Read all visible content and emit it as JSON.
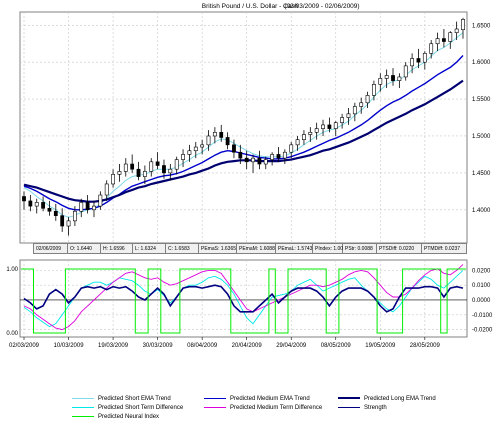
{
  "title": "British Pound / U.S. Dollar - Cash",
  "date_range": "(02/03/2009 - 02/06/2009)",
  "info_strip": [
    "02/06/2009",
    "O: 1.6440",
    "H: 1.6596",
    "L: 1.6324",
    "C: 1.6583",
    "PEmaS: 1.6365",
    "PEmaM: 1.6088",
    "PEmaL: 1.5743",
    "PIndex: 1.00",
    "PStr: 0.0088",
    "PTSDiff: 0.0220",
    "PTMDiff: 0.0237"
  ],
  "colors": {
    "short_ema": "#80d8e8",
    "medium_ema": "#0000cc",
    "long_ema": "#000070",
    "short_diff": "#00e8e8",
    "medium_diff": "#dd00dd",
    "strength": "#000080",
    "neural": "#00ee00",
    "candle": "#000000"
  },
  "chart_data": [
    {
      "type": "candlestick",
      "ylim": [
        1.355,
        1.668
      ],
      "y_ticks": [
        "1.4000",
        "1.4500",
        "1.5000",
        "1.5500",
        "1.6000",
        "1.6500"
      ],
      "x_ticks": [
        "02/03/2009",
        "10/03/2009",
        "19/03/2009",
        "30/03/2009",
        "08/04/2009",
        "20/04/2009",
        "29/04/2009",
        "08/05/2009",
        "19/05/2009",
        "28/05/2009"
      ],
      "ohlc": [
        [
          1.418,
          1.425,
          1.4,
          1.412
        ],
        [
          1.412,
          1.42,
          1.398,
          1.405
        ],
        [
          1.405,
          1.415,
          1.395,
          1.41
        ],
        [
          1.41,
          1.418,
          1.398,
          1.402
        ],
        [
          1.402,
          1.412,
          1.392,
          1.398
        ],
        [
          1.398,
          1.408,
          1.385,
          1.392
        ],
        [
          1.392,
          1.402,
          1.37,
          1.378
        ],
        [
          1.378,
          1.39,
          1.365,
          1.385
        ],
        [
          1.385,
          1.405,
          1.378,
          1.398
        ],
        [
          1.398,
          1.415,
          1.39,
          1.41
        ],
        [
          1.41,
          1.42,
          1.395,
          1.4
        ],
        [
          1.4,
          1.412,
          1.39,
          1.405
        ],
        [
          1.405,
          1.425,
          1.4,
          1.42
        ],
        [
          1.42,
          1.44,
          1.412,
          1.435
        ],
        [
          1.435,
          1.455,
          1.43,
          1.448
        ],
        [
          1.448,
          1.462,
          1.438,
          1.452
        ],
        [
          1.452,
          1.47,
          1.445,
          1.462
        ],
        [
          1.462,
          1.475,
          1.45,
          1.455
        ],
        [
          1.455,
          1.465,
          1.44,
          1.445
        ],
        [
          1.445,
          1.46,
          1.435,
          1.452
        ],
        [
          1.452,
          1.47,
          1.445,
          1.465
        ],
        [
          1.465,
          1.478,
          1.455,
          1.46
        ],
        [
          1.46,
          1.468,
          1.442,
          1.45
        ],
        [
          1.45,
          1.462,
          1.44,
          1.455
        ],
        [
          1.455,
          1.472,
          1.448,
          1.468
        ],
        [
          1.468,
          1.482,
          1.458,
          1.475
        ],
        [
          1.475,
          1.488,
          1.465,
          1.48
        ],
        [
          1.48,
          1.492,
          1.47,
          1.485
        ],
        [
          1.485,
          1.495,
          1.475,
          1.488
        ],
        [
          1.488,
          1.508,
          1.48,
          1.5
        ],
        [
          1.5,
          1.512,
          1.49,
          1.505
        ],
        [
          1.505,
          1.515,
          1.492,
          1.498
        ],
        [
          1.498,
          1.505,
          1.482,
          1.488
        ],
        [
          1.488,
          1.495,
          1.47,
          1.478
        ],
        [
          1.478,
          1.488,
          1.462,
          1.47
        ],
        [
          1.47,
          1.48,
          1.455,
          1.465
        ],
        [
          1.465,
          1.475,
          1.45,
          1.47
        ],
        [
          1.47,
          1.48,
          1.455,
          1.462
        ],
        [
          1.462,
          1.472,
          1.455,
          1.468
        ],
        [
          1.468,
          1.478,
          1.46,
          1.475
        ],
        [
          1.475,
          1.485,
          1.465,
          1.47
        ],
        [
          1.47,
          1.482,
          1.462,
          1.478
        ],
        [
          1.478,
          1.492,
          1.47,
          1.488
        ],
        [
          1.488,
          1.5,
          1.48,
          1.495
        ],
        [
          1.495,
          1.508,
          1.488,
          1.502
        ],
        [
          1.502,
          1.512,
          1.492,
          1.505
        ],
        [
          1.505,
          1.518,
          1.495,
          1.51
        ],
        [
          1.51,
          1.522,
          1.5,
          1.515
        ],
        [
          1.515,
          1.525,
          1.505,
          1.51
        ],
        [
          1.51,
          1.52,
          1.5,
          1.518
        ],
        [
          1.518,
          1.53,
          1.51,
          1.525
        ],
        [
          1.525,
          1.538,
          1.515,
          1.53
        ],
        [
          1.53,
          1.545,
          1.52,
          1.54
        ],
        [
          1.54,
          1.552,
          1.53,
          1.545
        ],
        [
          1.545,
          1.56,
          1.538,
          1.555
        ],
        [
          1.555,
          1.575,
          1.548,
          1.57
        ],
        [
          1.57,
          1.585,
          1.56,
          1.578
        ],
        [
          1.578,
          1.59,
          1.565,
          1.582
        ],
        [
          1.582,
          1.592,
          1.568,
          1.575
        ],
        [
          1.575,
          1.585,
          1.565,
          1.58
        ],
        [
          1.58,
          1.6,
          1.575,
          1.595
        ],
        [
          1.595,
          1.612,
          1.585,
          1.605
        ],
        [
          1.605,
          1.618,
          1.592,
          1.6
        ],
        [
          1.6,
          1.615,
          1.59,
          1.612
        ],
        [
          1.612,
          1.63,
          1.605,
          1.625
        ],
        [
          1.625,
          1.64,
          1.615,
          1.632
        ],
        [
          1.632,
          1.645,
          1.62,
          1.628
        ],
        [
          1.628,
          1.642,
          1.618,
          1.64
        ],
        [
          1.64,
          1.655,
          1.63,
          1.645
        ],
        [
          1.644,
          1.66,
          1.632,
          1.658
        ]
      ],
      "series": [
        {
          "key": "short_ema",
          "values": [
            1.43,
            1.425,
            1.418,
            1.412,
            1.405,
            1.4,
            1.393,
            1.39,
            1.392,
            1.397,
            1.4,
            1.402,
            1.408,
            1.416,
            1.425,
            1.432,
            1.44,
            1.445,
            1.447,
            1.448,
            1.452,
            1.455,
            1.455,
            1.455,
            1.458,
            1.463,
            1.468,
            1.474,
            1.478,
            1.485,
            1.492,
            1.496,
            1.495,
            1.49,
            1.485,
            1.48,
            1.476,
            1.473,
            1.472,
            1.472,
            1.472,
            1.473,
            1.477,
            1.482,
            1.488,
            1.494,
            1.5,
            1.505,
            1.508,
            1.51,
            1.515,
            1.52,
            1.528,
            1.535,
            1.543,
            1.553,
            1.562,
            1.57,
            1.574,
            1.576,
            1.582,
            1.59,
            1.595,
            1.6,
            1.608,
            1.616,
            1.62,
            1.626,
            1.633,
            1.64
          ]
        },
        {
          "key": "medium_ema",
          "values": [
            1.432,
            1.429,
            1.425,
            1.42,
            1.415,
            1.411,
            1.406,
            1.402,
            1.4,
            1.4,
            1.401,
            1.402,
            1.405,
            1.41,
            1.416,
            1.421,
            1.427,
            1.432,
            1.435,
            1.438,
            1.441,
            1.444,
            1.446,
            1.447,
            1.449,
            1.452,
            1.456,
            1.46,
            1.464,
            1.469,
            1.474,
            1.478,
            1.48,
            1.479,
            1.477,
            1.475,
            1.473,
            1.471,
            1.47,
            1.469,
            1.469,
            1.47,
            1.472,
            1.475,
            1.478,
            1.482,
            1.486,
            1.49,
            1.494,
            1.497,
            1.501,
            1.505,
            1.51,
            1.515,
            1.521,
            1.528,
            1.535,
            1.541,
            1.546,
            1.55,
            1.555,
            1.561,
            1.566,
            1.571,
            1.577,
            1.583,
            1.588,
            1.593,
            1.6,
            1.609
          ]
        },
        {
          "key": "long_ema",
          "values": [
            1.434,
            1.432,
            1.43,
            1.427,
            1.424,
            1.421,
            1.418,
            1.415,
            1.413,
            1.412,
            1.411,
            1.411,
            1.412,
            1.414,
            1.417,
            1.42,
            1.424,
            1.427,
            1.43,
            1.432,
            1.435,
            1.437,
            1.439,
            1.441,
            1.443,
            1.445,
            1.448,
            1.45,
            1.453,
            1.456,
            1.46,
            1.463,
            1.465,
            1.466,
            1.467,
            1.467,
            1.467,
            1.466,
            1.466,
            1.466,
            1.466,
            1.467,
            1.468,
            1.47,
            1.472,
            1.474,
            1.477,
            1.48,
            1.482,
            1.485,
            1.488,
            1.491,
            1.495,
            1.499,
            1.503,
            1.508,
            1.513,
            1.518,
            1.522,
            1.526,
            1.53,
            1.535,
            1.539,
            1.543,
            1.548,
            1.553,
            1.558,
            1.563,
            1.569,
            1.575
          ]
        }
      ]
    },
    {
      "type": "line",
      "left_ylim": [
        0.0,
        1.0
      ],
      "left_ticks": [
        "1.00",
        "0.00"
      ],
      "right_ylim": [
        -0.025,
        0.027
      ],
      "right_ticks": [
        "0.0200",
        "0.0100",
        "0.0000",
        "-0.0100",
        "-0.0200"
      ],
      "series": [
        {
          "key": "short_diff",
          "values": [
            -0.005,
            -0.008,
            -0.012,
            -0.015,
            -0.018,
            -0.016,
            -0.01,
            -0.004,
            0.002,
            0.008,
            0.01,
            0.012,
            0.012,
            0.01,
            0.012,
            0.015,
            0.014,
            0.013,
            0.01,
            0.006,
            0.004,
            0.007,
            0.003,
            -0.002,
            0.002,
            0.008,
            0.01,
            0.01,
            0.012,
            0.015,
            0.016,
            0.014,
            0.01,
            0.004,
            -0.004,
            -0.012,
            -0.016,
            -0.01,
            -0.004,
            0.002,
            0.003,
            0.004,
            0.006,
            0.01,
            0.012,
            0.014,
            0.01,
            0.006,
            0.008,
            0.01,
            0.012,
            0.014,
            0.015,
            0.01,
            0.006,
            0.002,
            -0.002,
            -0.006,
            -0.008,
            -0.004,
            0.002,
            0.008,
            0.012,
            0.016,
            0.014,
            0.01,
            0.008,
            0.012,
            0.016,
            0.02
          ]
        },
        {
          "key": "medium_diff",
          "values": [
            -0.004,
            -0.006,
            -0.01,
            -0.013,
            -0.016,
            -0.019,
            -0.02,
            -0.018,
            -0.014,
            -0.008,
            -0.004,
            0.0,
            0.004,
            0.008,
            0.012,
            0.015,
            0.018,
            0.019,
            0.017,
            0.015,
            0.014,
            0.015,
            0.012,
            0.01,
            0.011,
            0.013,
            0.015,
            0.017,
            0.019,
            0.02,
            0.02,
            0.018,
            0.012,
            0.006,
            0.0,
            -0.006,
            -0.008,
            -0.006,
            -0.004,
            -0.002,
            0.0,
            0.002,
            0.004,
            0.006,
            0.008,
            0.01,
            0.01,
            0.009,
            0.01,
            0.012,
            0.014,
            0.017,
            0.019,
            0.02,
            0.019,
            0.015,
            0.01,
            0.005,
            0.002,
            0.002,
            0.004,
            0.008,
            0.013,
            0.017,
            0.02,
            0.021,
            0.018,
            0.017,
            0.02,
            0.024
          ]
        },
        {
          "key": "strength",
          "values": [
            0.001,
            -0.002,
            -0.006,
            -0.004,
            0.004,
            0.007,
            0.004,
            -0.002,
            0.002,
            0.008,
            0.009,
            0.008,
            0.009,
            0.007,
            0.009,
            0.008,
            0.009,
            0.006,
            0.002,
            0.0,
            0.004,
            0.008,
            0.004,
            -0.004,
            0.002,
            0.008,
            0.009,
            0.009,
            0.008,
            0.009,
            0.01,
            0.009,
            0.004,
            -0.004,
            -0.008,
            -0.008,
            -0.008,
            -0.004,
            0.0,
            0.004,
            -0.002,
            0.002,
            0.006,
            0.008,
            0.008,
            0.008,
            0.006,
            0.002,
            -0.004,
            0.002,
            0.006,
            0.008,
            0.008,
            0.008,
            0.006,
            0.002,
            -0.004,
            -0.008,
            -0.006,
            0.002,
            0.008,
            0.008,
            0.008,
            0.009,
            0.009,
            0.008,
            0.002,
            0.008,
            0.009,
            0.008
          ]
        },
        {
          "key": "neural",
          "values": [
            1,
            1,
            0,
            0,
            0,
            0,
            0,
            1,
            1,
            1,
            1,
            1,
            1,
            1,
            1,
            1,
            1,
            1,
            0,
            0,
            1,
            1,
            0,
            0,
            0,
            1,
            1,
            1,
            1,
            1,
            1,
            1,
            1,
            0,
            0,
            0,
            0,
            0,
            0,
            1,
            0,
            0,
            1,
            1,
            1,
            1,
            1,
            1,
            0,
            0,
            1,
            1,
            1,
            1,
            1,
            1,
            0,
            0,
            0,
            0,
            1,
            1,
            1,
            1,
            1,
            1,
            0,
            1,
            1,
            1
          ]
        }
      ]
    }
  ],
  "legend": [
    {
      "key": "short_ema",
      "label": "Predicted Short EMA Trend"
    },
    {
      "key": "medium_ema",
      "label": "Predicted Medium EMA Trend"
    },
    {
      "key": "long_ema",
      "label": "Predicted Long EMA Trend"
    },
    {
      "key": "short_diff",
      "label": "Predicted Short Term Difference"
    },
    {
      "key": "medium_diff",
      "label": "Predicted Medium Term Difference"
    },
    {
      "key": "strength",
      "label": "Strength"
    },
    {
      "key": "neural",
      "label": "Predicted Neural Index"
    }
  ]
}
